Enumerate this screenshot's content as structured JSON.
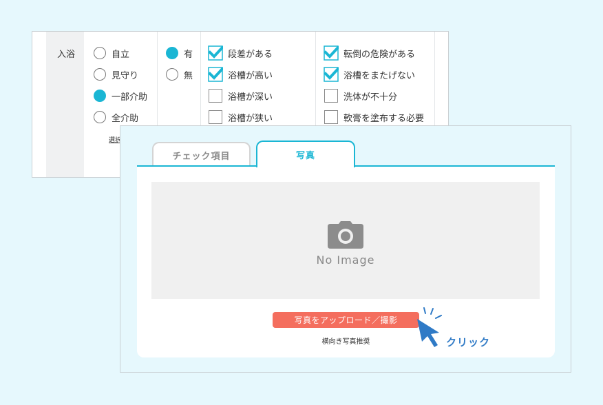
{
  "back_form": {
    "row_label": "入浴",
    "assistance_options": [
      {
        "label": "自立",
        "selected": false
      },
      {
        "label": "見守り",
        "selected": false
      },
      {
        "label": "一部介助",
        "selected": true
      },
      {
        "label": "全介助",
        "selected": false
      }
    ],
    "presence_options": [
      {
        "label": "有",
        "selected": true
      },
      {
        "label": "無",
        "selected": false
      }
    ],
    "checks_col1": [
      {
        "label": "段差がある",
        "checked": true
      },
      {
        "label": "浴槽が高い",
        "checked": true
      },
      {
        "label": "浴槽が深い",
        "checked": false
      },
      {
        "label": "浴槽が狭い",
        "checked": false
      }
    ],
    "checks_col2": [
      {
        "label": "転倒の危険がある",
        "checked": true
      },
      {
        "label": "浴槽をまたげない",
        "checked": true
      },
      {
        "label": "洗体が不十分",
        "checked": false
      },
      {
        "label": "軟膏を塗布する必要",
        "checked": false
      }
    ],
    "select_link": "選択"
  },
  "tabs": [
    {
      "label": "チェック項目",
      "active": false
    },
    {
      "label": "写真",
      "active": true
    }
  ],
  "photo_panel": {
    "placeholder_text": "No Image",
    "upload_button": "写真をアップロード／撮影",
    "hint": "横向き写真推奨"
  },
  "annotation": {
    "click_label": "クリック"
  },
  "colors": {
    "accent": "#1ab6d4",
    "upload": "#f46e5e",
    "annotation": "#2f7ac6",
    "background": "#e6f8fd"
  },
  "icons": {
    "camera": "camera-icon",
    "cursor": "cursor-arrow-icon"
  }
}
